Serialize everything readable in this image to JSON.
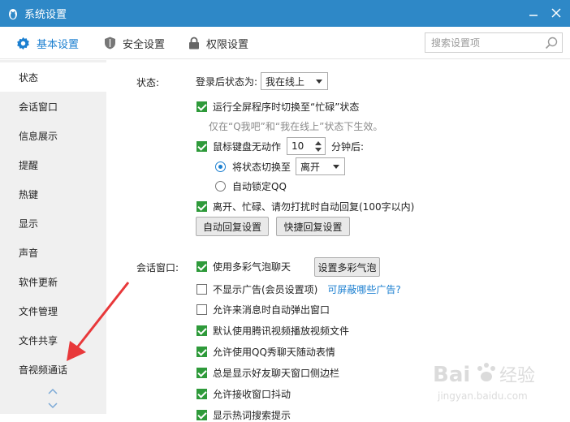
{
  "window": {
    "title": "系统设置"
  },
  "tabs": [
    {
      "label": "基本设置",
      "icon": "gear-icon"
    },
    {
      "label": "安全设置",
      "icon": "shield-icon"
    },
    {
      "label": "权限设置",
      "icon": "lock-icon"
    }
  ],
  "search": {
    "placeholder": "搜索设置项"
  },
  "sidebar": {
    "items": [
      "状态",
      "会话窗口",
      "信息展示",
      "提醒",
      "热键",
      "显示",
      "声音",
      "软件更新",
      "文件管理",
      "文件共享",
      "音视频通话"
    ]
  },
  "status": {
    "section_label": "状态:",
    "login_status_label": "登录后状态为:",
    "login_status_value": "我在线上",
    "fullscreen_busy": "运行全屏程序时切换至“忙碌”状态",
    "fullscreen_hint": "仅在“Q我吧”和“我在线上”状态下生效。",
    "idle_prefix": "鼠标键盘无动作",
    "idle_minutes": "10",
    "idle_suffix": "分钟后:",
    "switch_to_label": "将状态切换至",
    "switch_to_value": "离开",
    "auto_lock": "自动锁定QQ",
    "auto_reply": "离开、忙碌、请勿打扰时自动回复(100字以内)",
    "auto_reply_settings_btn": "自动回复设置",
    "quick_reply_settings_btn": "快捷回复设置"
  },
  "chat": {
    "section_label": "会话窗口:",
    "bubble_label": "使用多彩气泡聊天",
    "bubble_btn": "设置多彩气泡",
    "no_ads_label": "不显示广告(会员设置项)",
    "no_ads_link": "可屏蔽哪些广告?",
    "auto_popup": "允许来消息时自动弹出窗口",
    "tencent_video": "默认使用腾讯视频播放视频文件",
    "qq_show": "允许使用QQ秀聊天随动表情",
    "sidebar_always": "总是显示好友聊天窗口侧边栏",
    "window_shake": "允许接收窗口抖动",
    "cut_off": "显示热词搜索提示"
  },
  "watermark": {
    "brand": "Bai",
    "brand2": "经验",
    "url": "jingyan.baidu.com"
  },
  "colors": {
    "titlebar": "#2e88c7",
    "accent": "#1b7fd0",
    "checkbox": "#2e9a3a",
    "arrow": "#e8383a"
  }
}
